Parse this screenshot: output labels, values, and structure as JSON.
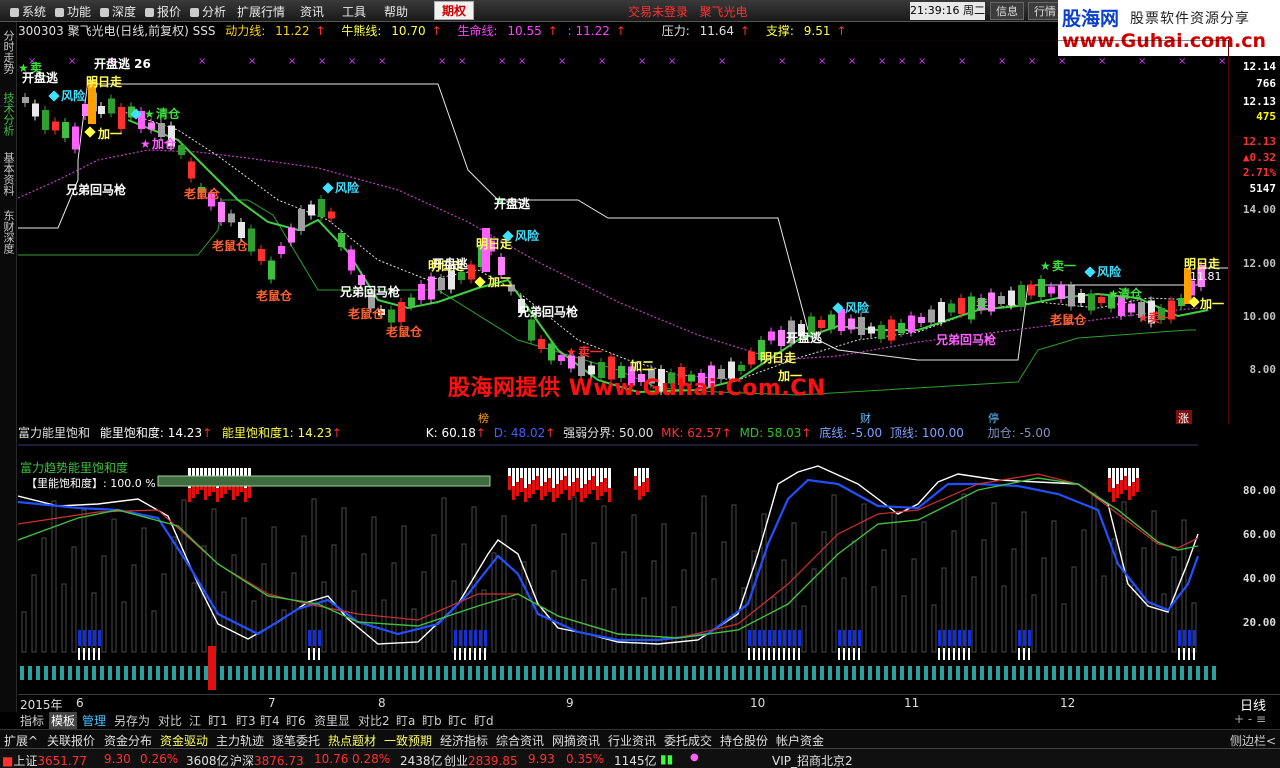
{
  "menu": {
    "items": [
      "系统",
      "功能",
      "深度",
      "报价",
      "分析",
      "扩展行情",
      "资讯",
      "工具",
      "帮助"
    ],
    "qiquan": "期权",
    "trade_status": "交易未登录",
    "stock_short": "聚飞光电",
    "clock": "21:39:16 周二",
    "btn_xinxi": "信息",
    "btn_hangqing": "行情"
  },
  "logo": {
    "brand": "股海网",
    "tagline": "股票软件资源分享",
    "url": "www.Guhai.com.cn"
  },
  "sidebar": {
    "tabs": [
      "分时走势",
      "技术分析",
      "基本资料",
      "东财深度"
    ]
  },
  "info": {
    "code_name": "300303 聚飞光电(日线,前复权) SSS",
    "dongli_label": "动力线:",
    "dongli_value": "11.22",
    "niuxiong_label": "牛熊线:",
    "niuxiong_value": "10.70",
    "shengming_label": "生命线:",
    "shengming_value": "10.55",
    "shengming_value2": ": 11.22",
    "yali_label": "压力:",
    "yali_value": "11.64",
    "zhicheng_label": "支撑:",
    "zhicheng_value": "9.51",
    "arrow_up": "↑"
  },
  "main_axis": [
    "12.14",
    "766",
    "12.13",
    "475",
    "12.13",
    "0.32",
    "2.71%",
    "5147",
    "14.00",
    "12.00",
    "10.00",
    "8.00"
  ],
  "main_axis_colors": [
    "#ffffff",
    "#ffffff",
    "#ffffff",
    "#ffff00",
    "#ff3030",
    "#ff3030",
    "#ff3030",
    "#ffffff",
    "#c0c0c0",
    "#c0c0c0",
    "#c0c0c0",
    "#c0c0c0"
  ],
  "annotations": {
    "sell": "卖",
    "kaipan_escape": "开盘逃",
    "kaipan_26": "开盘逃 26",
    "ming_ri_zou": "明日走",
    "feng_xian": "风险",
    "qing_cang": "清仓",
    "jia_cang": "加仓",
    "jia_yi": "加一",
    "jia_er": "加二",
    "xiong_di": "兄弟回马枪",
    "lao_shu_cang": "老鼠仓",
    "mai_yi": "卖一",
    "peak_value": "11.81"
  },
  "watermark": "股海网提供 Www.Guhai.Com.CN",
  "event_labels": [
    "榜",
    "财",
    "停",
    "涨"
  ],
  "sub": {
    "title": "富力能里饱和",
    "label1": "能里饱和度:",
    "value1": "14.23",
    "label2": "能里饱和度1:",
    "value2": "14.23",
    "k_label": "K:",
    "k_value": "60.18",
    "d_label": "D:",
    "d_value": "48.02",
    "qr_label": "强弱分界:",
    "qr_value": "50.00",
    "mk_label": "MK:",
    "mk_value": "62.57",
    "md_label": "MD:",
    "md_value": "58.03",
    "di_label": "底线:",
    "di_value": "-5.00",
    "ding_label": "顶线:",
    "ding_value": "100.00",
    "jia_label": "加仓:",
    "jia_value": "-5.00",
    "panel_title": "富力趋势能里饱和度",
    "panel_line": "【里能饱和度】: 100.0 %"
  },
  "sub_axis": [
    "80.00",
    "60.00",
    "40.00",
    "20.00"
  ],
  "date_axis": [
    "2015年",
    "6",
    "7",
    "8",
    "9",
    "10",
    "11",
    "12"
  ],
  "period": "日线",
  "bottom_tabs": [
    "指标",
    "模板",
    "管理",
    "另存为",
    "对比",
    "江",
    "盯1",
    "盯3",
    "盯4",
    "盯6",
    "资里显",
    "对比2",
    "盯a",
    "盯b",
    "盯c",
    "盯d"
  ],
  "bottom_right": "+ - ≡",
  "bottom_links": [
    "扩展^",
    "关联报价",
    "资金分布",
    "资金驱动",
    "主力轨迹",
    "逐笔委托",
    "热点题材",
    "一致预期",
    "经济指标",
    "综合资讯",
    "网摘资讯",
    "行业资讯",
    "委托成交",
    "持仓股份",
    "帐户资金"
  ],
  "side_toggle": "侧边栏<",
  "status": {
    "sh_label": "上证",
    "sh_value": "3651.77",
    "sh_change": "9.30",
    "sh_pct": "0.26%",
    "sh_amount": "3608亿",
    "hs_label": "沪深",
    "hs_value": "3876.73",
    "hs_change": "10.76",
    "hs_pct": "0.28%",
    "hs_amount": "2438亿",
    "cy_label": "创业",
    "cy_value": "2839.85",
    "cy_change": "9.93",
    "cy_pct": "0.35%",
    "cy_amount": "1145亿",
    "vip": "VIP_招商北京2"
  }
}
